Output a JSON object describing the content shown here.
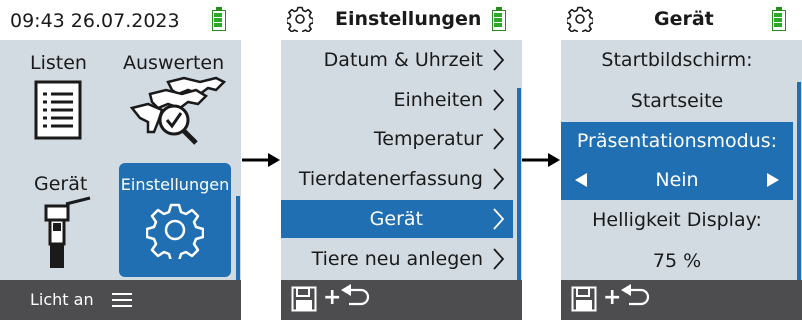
{
  "colors": {
    "background": "#d3dbe2",
    "accent": "#1f6fb2",
    "bottom_bar": "#4d4d4f",
    "battery": "#2ea82a"
  },
  "screen1": {
    "clock": "09:43 26.07.2023",
    "tiles": [
      {
        "label": "Listen",
        "icon": "list-document-icon"
      },
      {
        "label": "Auswerten",
        "icon": "evaluate-animals-icon"
      },
      {
        "label": "Gerät",
        "icon": "handheld-device-icon"
      },
      {
        "label": "Einstellungen",
        "icon": "gear-icon",
        "selected": true
      }
    ],
    "bottom": {
      "light_label": "Licht an",
      "menu_icon": "hamburger-menu-icon"
    }
  },
  "screen2": {
    "title": "Einstellungen",
    "items": [
      {
        "label": "Datum & Uhrzeit"
      },
      {
        "label": "Einheiten"
      },
      {
        "label": "Temperatur"
      },
      {
        "label": "Tierdatenerfassung"
      },
      {
        "label": "Gerät",
        "selected": true
      },
      {
        "label": "Tiere neu anlegen"
      }
    ],
    "bottom_icons": [
      "save-icon",
      "plus-icon",
      "back-icon"
    ]
  },
  "screen3": {
    "title": "Gerät",
    "startscreen_label": "Startbildschirm:",
    "startscreen_value": "Startseite",
    "presentation_label": "Präsentationsmodus:",
    "presentation_value": "Nein",
    "brightness_label": "Helligkeit Display:",
    "brightness_value": "75 %",
    "bottom_icons": [
      "save-icon",
      "plus-icon",
      "back-icon"
    ]
  }
}
